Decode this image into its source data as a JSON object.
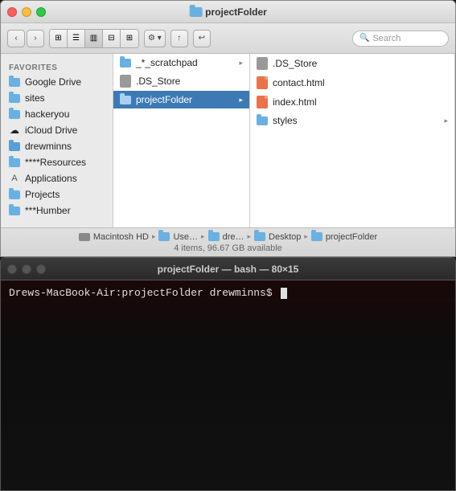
{
  "finder": {
    "title": "projectFolder",
    "traffic_lights": [
      "close",
      "minimize",
      "maximize"
    ],
    "toolbar": {
      "back_label": "‹",
      "forward_label": "›",
      "view_icon_1": "⊞",
      "view_icon_2": "☰",
      "view_icon_3": "⊟",
      "view_icon_4": "▥",
      "view_icon_5": "⊞",
      "action_label": "⚙",
      "share_label": "↑",
      "edit_label": "↩",
      "search_placeholder": "Search"
    },
    "sidebar": {
      "section_label": "Favorites",
      "items": [
        {
          "label": "Google Drive",
          "icon": "folder"
        },
        {
          "label": "sites",
          "icon": "folder"
        },
        {
          "label": "hackeryou",
          "icon": "folder"
        },
        {
          "label": "iCloud Drive",
          "icon": "drive"
        },
        {
          "label": "drewminns",
          "icon": "folder"
        },
        {
          "label": "****Resources",
          "icon": "folder"
        },
        {
          "label": "Applications",
          "icon": "apps"
        },
        {
          "label": "Projects",
          "icon": "folder"
        },
        {
          "label": "***Humber",
          "icon": "folder"
        }
      ]
    },
    "columns": {
      "col1": {
        "items": [
          {
            "label": "_*_scratchpad",
            "icon": "folder",
            "has_arrow": true
          },
          {
            "label": ".DS_Store",
            "icon": "ds"
          },
          {
            "label": "projectFolder",
            "icon": "folder",
            "selected": true,
            "has_arrow": true
          }
        ]
      },
      "col2": {
        "items": [
          {
            "label": ".DS_Store",
            "icon": "ds"
          },
          {
            "label": "contact.html",
            "icon": "html"
          },
          {
            "label": "index.html",
            "icon": "html"
          },
          {
            "label": "styles",
            "icon": "folder",
            "has_arrow": true
          }
        ]
      }
    },
    "status": {
      "path_items": [
        {
          "label": "Macintosh HD",
          "icon": "hd"
        },
        {
          "label": "Use…",
          "icon": "folder"
        },
        {
          "label": "dre…",
          "icon": "folder"
        },
        {
          "label": "Desktop",
          "icon": "folder"
        },
        {
          "label": "projectFolder",
          "icon": "folder"
        }
      ],
      "disk_info": "4 items, 96.67 GB available"
    }
  },
  "terminal": {
    "title": "projectFolder — bash — 80×15",
    "prompt": "Drews-MacBook-Air:projectFolder drewminns$ "
  }
}
